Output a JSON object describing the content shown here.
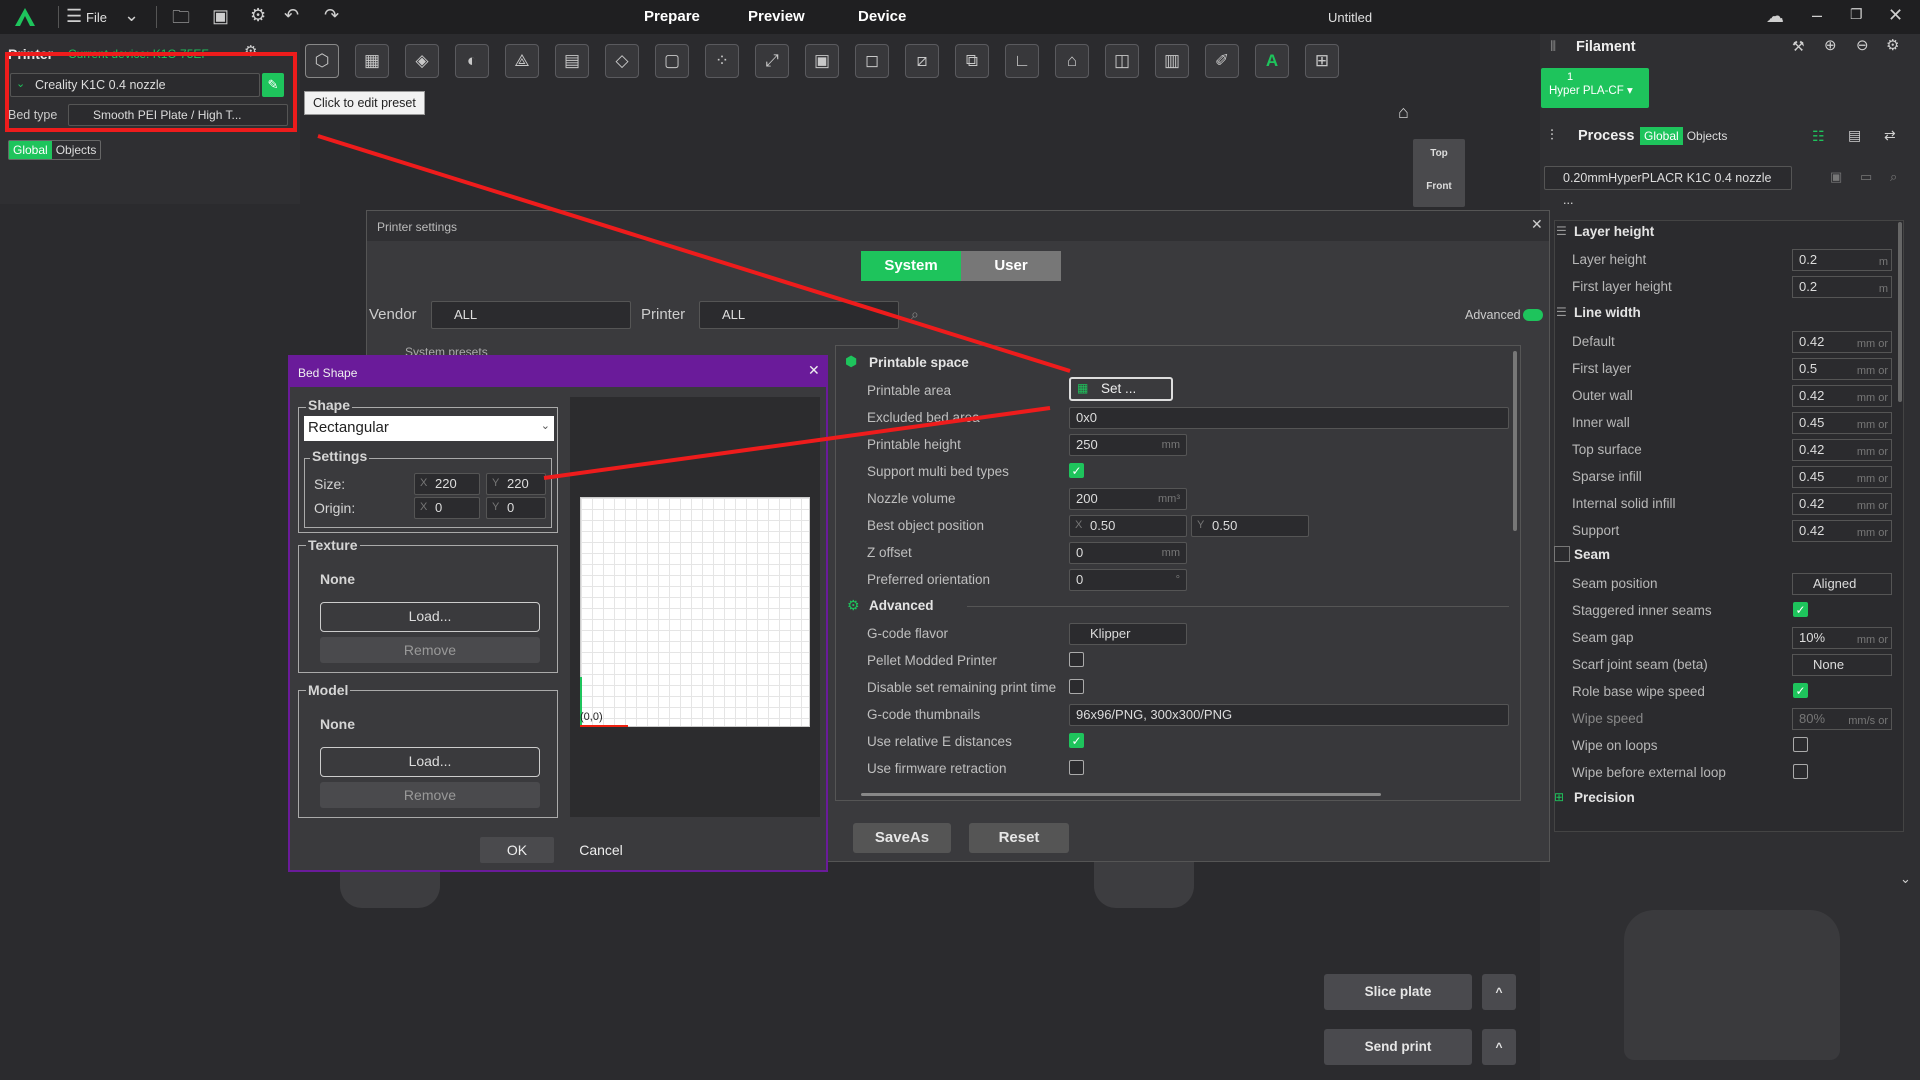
{
  "topbar": {
    "file": "File",
    "tabs": [
      "Prepare",
      "Preview",
      "Device"
    ],
    "title": "Untitled"
  },
  "left": {
    "printer_label": "Printer",
    "device_label": "Current device: K1C-75EF",
    "preset": "Creality K1C 0.4 nozzle",
    "bed_type_label": "Bed type",
    "bed_type": "Smooth PEI Plate / High T...",
    "toggle": [
      "Global",
      "Objects"
    ],
    "tooltip": "Click to edit preset"
  },
  "viewcube": {
    "top": "Top",
    "front": "Front"
  },
  "filament": {
    "title": "Filament",
    "slot_num": "1",
    "slot_name": "Hyper PLA-CF"
  },
  "process": {
    "title": "Process",
    "toggle": [
      "Global",
      "Objects"
    ],
    "preset": "0.20mmHyperPLACR K1C 0.4 nozzle ...",
    "sections": [
      {
        "name": "Layer height",
        "rows": [
          {
            "label": "Layer height",
            "value": "0.2",
            "unit": "m"
          },
          {
            "label": "First layer height",
            "value": "0.2",
            "unit": "m"
          }
        ]
      },
      {
        "name": "Line width",
        "rows": [
          {
            "label": "Default",
            "value": "0.42",
            "unit": "mm or"
          },
          {
            "label": "First layer",
            "value": "0.5",
            "unit": "mm or"
          },
          {
            "label": "Outer wall",
            "value": "0.42",
            "unit": "mm or"
          },
          {
            "label": "Inner wall",
            "value": "0.45",
            "unit": "mm or"
          },
          {
            "label": "Top surface",
            "value": "0.42",
            "unit": "mm or"
          },
          {
            "label": "Sparse infill",
            "value": "0.45",
            "unit": "mm or"
          },
          {
            "label": "Internal solid infill",
            "value": "0.42",
            "unit": "mm or"
          },
          {
            "label": "Support",
            "value": "0.42",
            "unit": "mm or"
          }
        ]
      },
      {
        "name": "Seam"
      }
    ],
    "seam": {
      "position_label": "Seam position",
      "position": "Aligned",
      "staggered": "Staggered inner seams",
      "gap_label": "Seam gap",
      "gap": "10%",
      "gap_unit": "mm or",
      "scarf_label": "Scarf joint seam (beta)",
      "scarf": "None",
      "role_label": "Role base wipe speed",
      "wipe_speed_label": "Wipe speed",
      "wipe_speed": "80%",
      "wipe_speed_unit": "mm/s or",
      "wipe_loops": "Wipe on loops",
      "wipe_before": "Wipe before external loop"
    },
    "precision": "Precision"
  },
  "bottom": {
    "slice": "Slice plate",
    "send": "Send print"
  },
  "printer_settings": {
    "title": "Printer settings",
    "system": "System",
    "user": "User",
    "vendor_label": "Vendor",
    "vendor": "ALL",
    "printer_label": "Printer",
    "printer": "ALL",
    "advanced": "Advanced",
    "system_presets": "System presets",
    "printable_space": "Printable space",
    "printable_area": "Printable area",
    "set_btn": "Set ...",
    "excluded": "Excluded bed area",
    "excluded_val": "0x0",
    "height": "Printable height",
    "height_val": "250",
    "mm": "mm",
    "multi_bed": "Support multi bed types",
    "nozzle_volume": "Nozzle volume",
    "nozzle_volume_val": "200",
    "mm3": "mm³",
    "best_pos": "Best object position",
    "best_x": "0.50",
    "best_y": "0.50",
    "zoffset": "Z offset",
    "zoffset_val": "0",
    "pref_orient": "Preferred orientation",
    "pref_orient_val": "0",
    "deg": "°",
    "advanced_section": "Advanced",
    "gcode_flavor": "G-code flavor",
    "gcode_flavor_val": "Klipper",
    "pellet": "Pellet Modded Printer",
    "disable_remaining": "Disable set remaining print time",
    "thumbnails": "G-code thumbnails",
    "thumbnails_val": "96x96/PNG, 300x300/PNG",
    "relative_e": "Use relative E distances",
    "firmware_retract": "Use firmware retraction",
    "saveas": "SaveAs",
    "reset": "Reset"
  },
  "bed_shape": {
    "title": "Bed Shape",
    "shape_label": "Shape",
    "shape": "Rectangular",
    "settings_label": "Settings",
    "size_label": "Size:",
    "origin_label": "Origin:",
    "size_x": "220",
    "size_y": "220",
    "origin_x": "0",
    "origin_y": "0",
    "x": "X",
    "y": "Y",
    "texture_label": "Texture",
    "texture_val": "None",
    "load": "Load...",
    "remove": "Remove",
    "model_label": "Model",
    "model_val": "None",
    "origin_mark": "(0,0)",
    "ok": "OK",
    "cancel": "Cancel"
  },
  "colors": {
    "accent": "#1ec45c",
    "annotation": "#ee1c1c",
    "bed_dialog_title": "#6a1b9a"
  }
}
